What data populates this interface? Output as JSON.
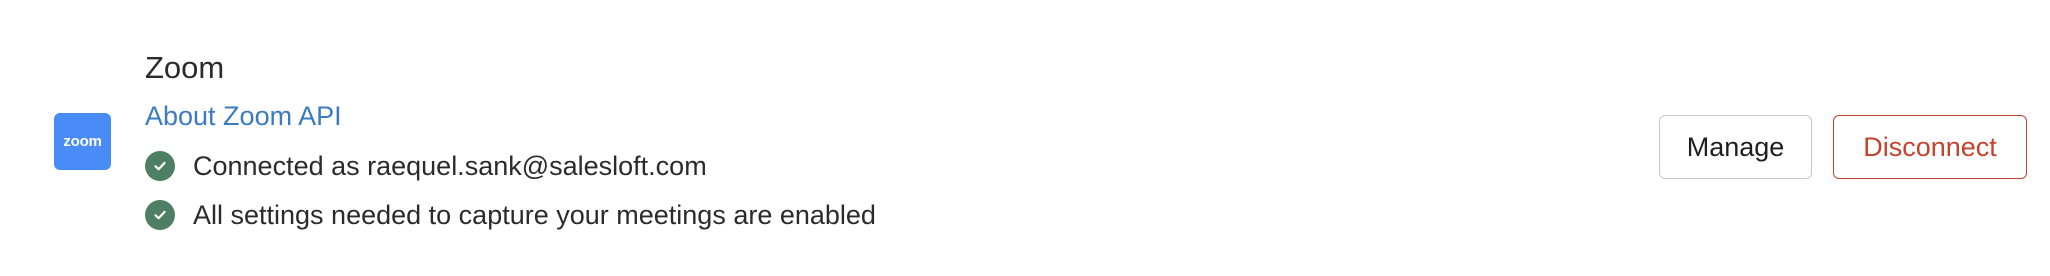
{
  "integration": {
    "logo_text": "zoom",
    "title": "Zoom",
    "about_link": "About Zoom API",
    "statuses": [
      {
        "icon": "check-circle-icon",
        "text": "Connected as raequel.sank@salesloft.com"
      },
      {
        "icon": "check-circle-icon",
        "text": "All settings needed to capture your meetings are enabled"
      }
    ]
  },
  "actions": {
    "manage_label": "Manage",
    "disconnect_label": "Disconnect"
  },
  "colors": {
    "logo_bg": "#4a8cf7",
    "link": "#3b7bbf",
    "check": "#4e7e64",
    "danger": "#c4432e"
  }
}
